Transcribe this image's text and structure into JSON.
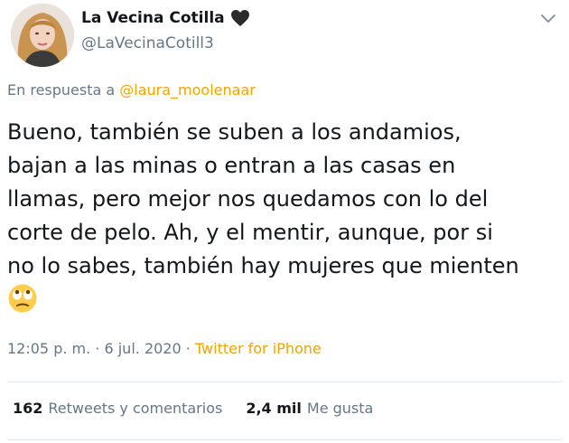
{
  "author": {
    "display_name": "La Vecina Cotilla",
    "handle": "@LaVecinaCotill3",
    "avatar_icon": "profile-photo",
    "badge_icon": "black-heart-icon"
  },
  "reply": {
    "prefix": "En respuesta a ",
    "mention": "@laura_moolenaar"
  },
  "tweet": {
    "text": "Bueno, también se suben a los andamios,\nbajan a las minas o entran a las casas en\nllamas, pero mejor nos quedamos con lo del\ncorte de pelo. Ah, y el mentir, aunque, por si\nno lo sabes, también hay mujeres que mienten\n",
    "emoji": "face-with-rolling-eyes"
  },
  "meta": {
    "time": "12:05 p. m.",
    "separator": " · ",
    "date": "6 jul. 2020",
    "source": "Twitter for iPhone"
  },
  "stats": {
    "retweets_count": "162",
    "retweets_label": "Retweets y comentarios",
    "likes_count": "2,4 mil",
    "likes_label": "Me gusta"
  },
  "colors": {
    "accent": "#f4a300",
    "secondary_text": "#657786",
    "primary_text": "#14171a",
    "divider": "#e1e8ed"
  }
}
